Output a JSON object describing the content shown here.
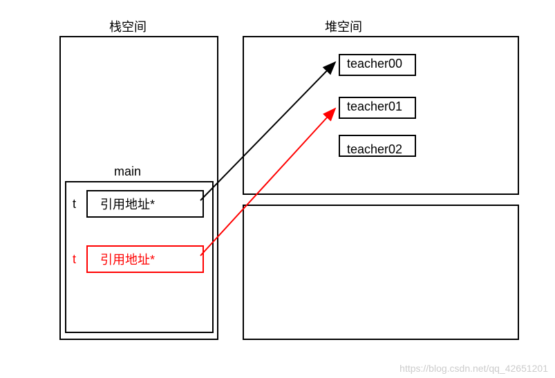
{
  "titles": {
    "stack": "栈空间",
    "heap": "堆空间"
  },
  "main": {
    "label": "main",
    "ref1": {
      "var": "t",
      "text": "引用地址*"
    },
    "ref2": {
      "var": "t",
      "text": "引用地址*"
    }
  },
  "heap": {
    "obj0": "teacher00",
    "obj1": "teacher01",
    "obj2": "teacher02"
  },
  "watermark": "https://blog.csdn.net/qq_42651201"
}
